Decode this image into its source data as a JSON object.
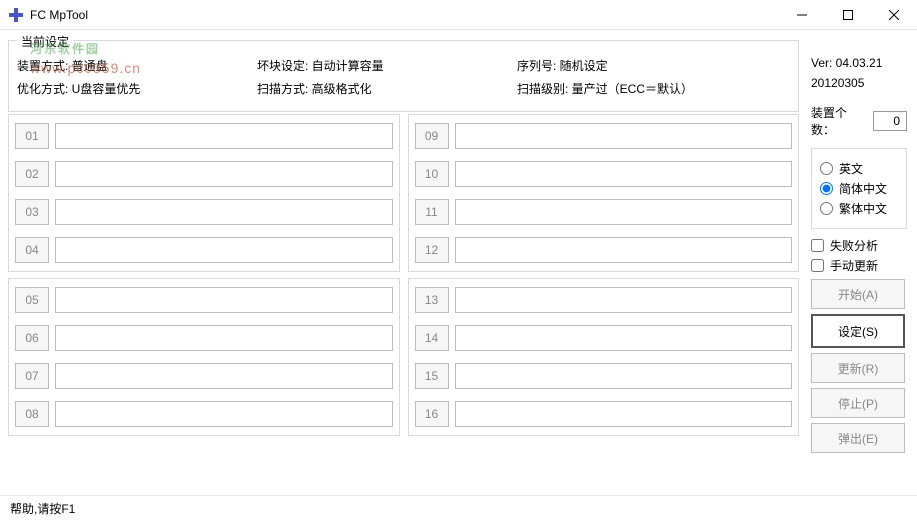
{
  "window": {
    "title": "FC MpTool"
  },
  "watermark": {
    "name": "河东软件园",
    "url": "www.pc0359.cn"
  },
  "settings": {
    "legend": "当前设定",
    "row1": {
      "a": "装置方式: 普通盘",
      "b": "坏块设定: 自动计算容量",
      "c": "序列号: 随机设定"
    },
    "row2": {
      "a": "优化方式: U盘容量优先",
      "b": "扫描方式: 高级格式化",
      "c": "扫描级别: 量产过（ECC＝默认）"
    }
  },
  "slots": {
    "left_top": [
      "01",
      "02",
      "03",
      "04"
    ],
    "left_bot": [
      "05",
      "06",
      "07",
      "08"
    ],
    "right_top": [
      "09",
      "10",
      "11",
      "12"
    ],
    "right_bot": [
      "13",
      "14",
      "15",
      "16"
    ]
  },
  "status": "帮助,请按F1",
  "side": {
    "ver": "Ver: 04.03.21",
    "date": "20120305",
    "count_label": "装置个数：",
    "count_value": "0",
    "lang": {
      "en": "英文",
      "cn": "简体中文",
      "tw": "繁体中文"
    },
    "chk_fail": "失败分析",
    "chk_manual": "手动更新",
    "btn_start": "开始(A)",
    "btn_set": "设定(S)",
    "btn_update": "更新(R)",
    "btn_stop": "停止(P)",
    "btn_eject": "弹出(E)"
  }
}
